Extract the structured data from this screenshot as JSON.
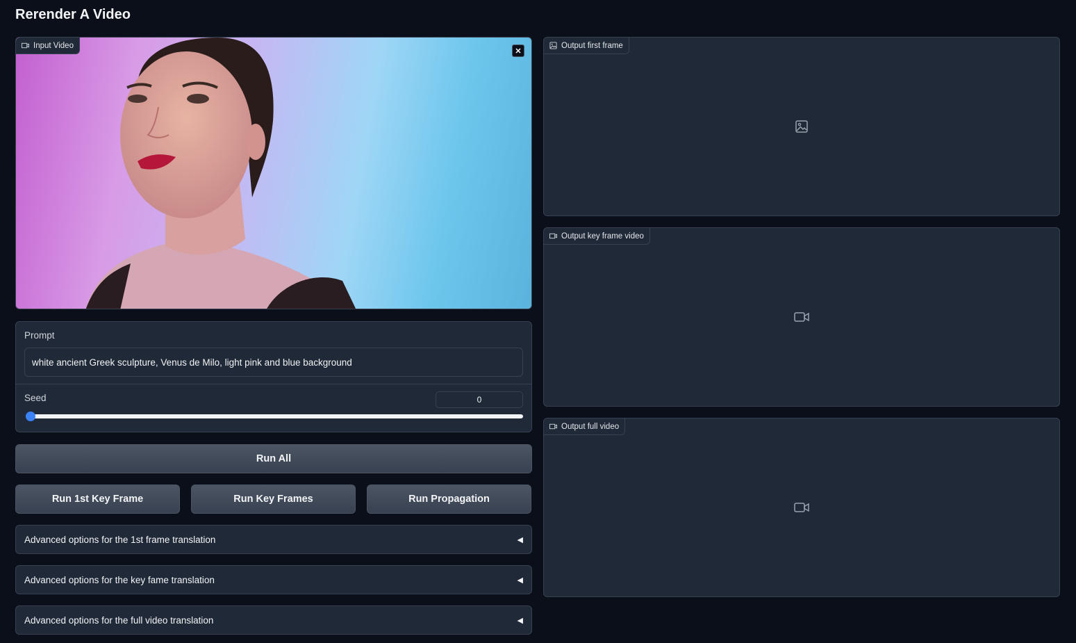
{
  "page": {
    "title": "Rerender A Video"
  },
  "input_video": {
    "label": "Input Video",
    "icon": "video-icon",
    "clear_icon": "close-icon"
  },
  "prompt": {
    "label": "Prompt",
    "value": "white ancient Greek sculpture, Venus de Milo, light pink and blue background"
  },
  "seed": {
    "label": "Seed",
    "value": "0",
    "slider_fraction": 0.0
  },
  "buttons": {
    "run_all": "Run All",
    "run_first_key_frame": "Run 1st Key Frame",
    "run_key_frames": "Run Key Frames",
    "run_propagation": "Run Propagation"
  },
  "accordions": [
    {
      "label": "Advanced options for the 1st frame translation",
      "icon": "collapse-caret-icon"
    },
    {
      "label": "Advanced options for the key fame translation",
      "icon": "collapse-caret-icon"
    },
    {
      "label": "Advanced options for the full video translation",
      "icon": "collapse-caret-icon"
    }
  ],
  "outputs": [
    {
      "label": "Output first frame",
      "icon": "image-icon"
    },
    {
      "label": "Output key frame video",
      "icon": "video-icon"
    },
    {
      "label": "Output full video",
      "icon": "video-icon"
    }
  ],
  "colors": {
    "background": "#0b0f19",
    "panel": "#1f2937",
    "border": "#374151",
    "accent": "#3b82f6"
  }
}
